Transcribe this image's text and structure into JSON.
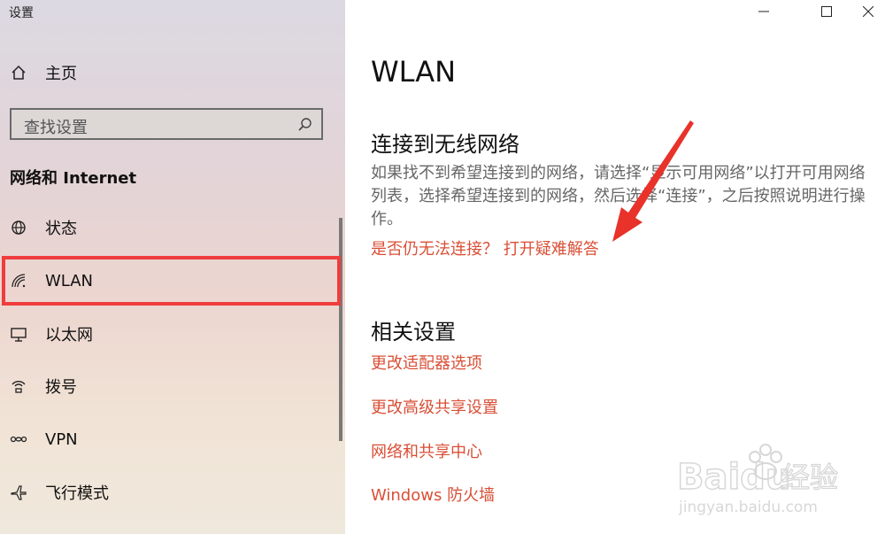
{
  "window": {
    "title": "设置"
  },
  "sidebar": {
    "home_label": "主页",
    "search_placeholder": "查找设置",
    "section_title": "网络和 Internet",
    "items": [
      {
        "label": "状态",
        "icon": "globe-icon"
      },
      {
        "label": "WLAN",
        "icon": "wifi-icon",
        "selected": true
      },
      {
        "label": "以太网",
        "icon": "ethernet-icon"
      },
      {
        "label": "拨号",
        "icon": "dialup-icon"
      },
      {
        "label": "VPN",
        "icon": "vpn-icon"
      },
      {
        "label": "飞行模式",
        "icon": "airplane-icon"
      }
    ]
  },
  "main": {
    "page_title": "WLAN",
    "connect_title": "连接到无线网络",
    "connect_desc": "如果找不到希望连接到的网络，请选择“显示可用网络”以打开可用网络列表，选择希望连接到的网络，然后选择“连接”，之后按照说明进行操作。",
    "troubleshoot_link": "是否仍无法连接？ 打开疑难解答",
    "related_title": "相关设置",
    "related_links": [
      "更改适配器选项",
      "更改高级共享设置",
      "网络和共享中心",
      "Windows 防火墙"
    ]
  },
  "watermark": {
    "brand": "Baidu",
    "suffix": "经验",
    "url": "jingyan.baidu.com"
  },
  "colors": {
    "link": "#d94f36",
    "highlight": "#f03c3c",
    "arrow": "#e8322a"
  }
}
